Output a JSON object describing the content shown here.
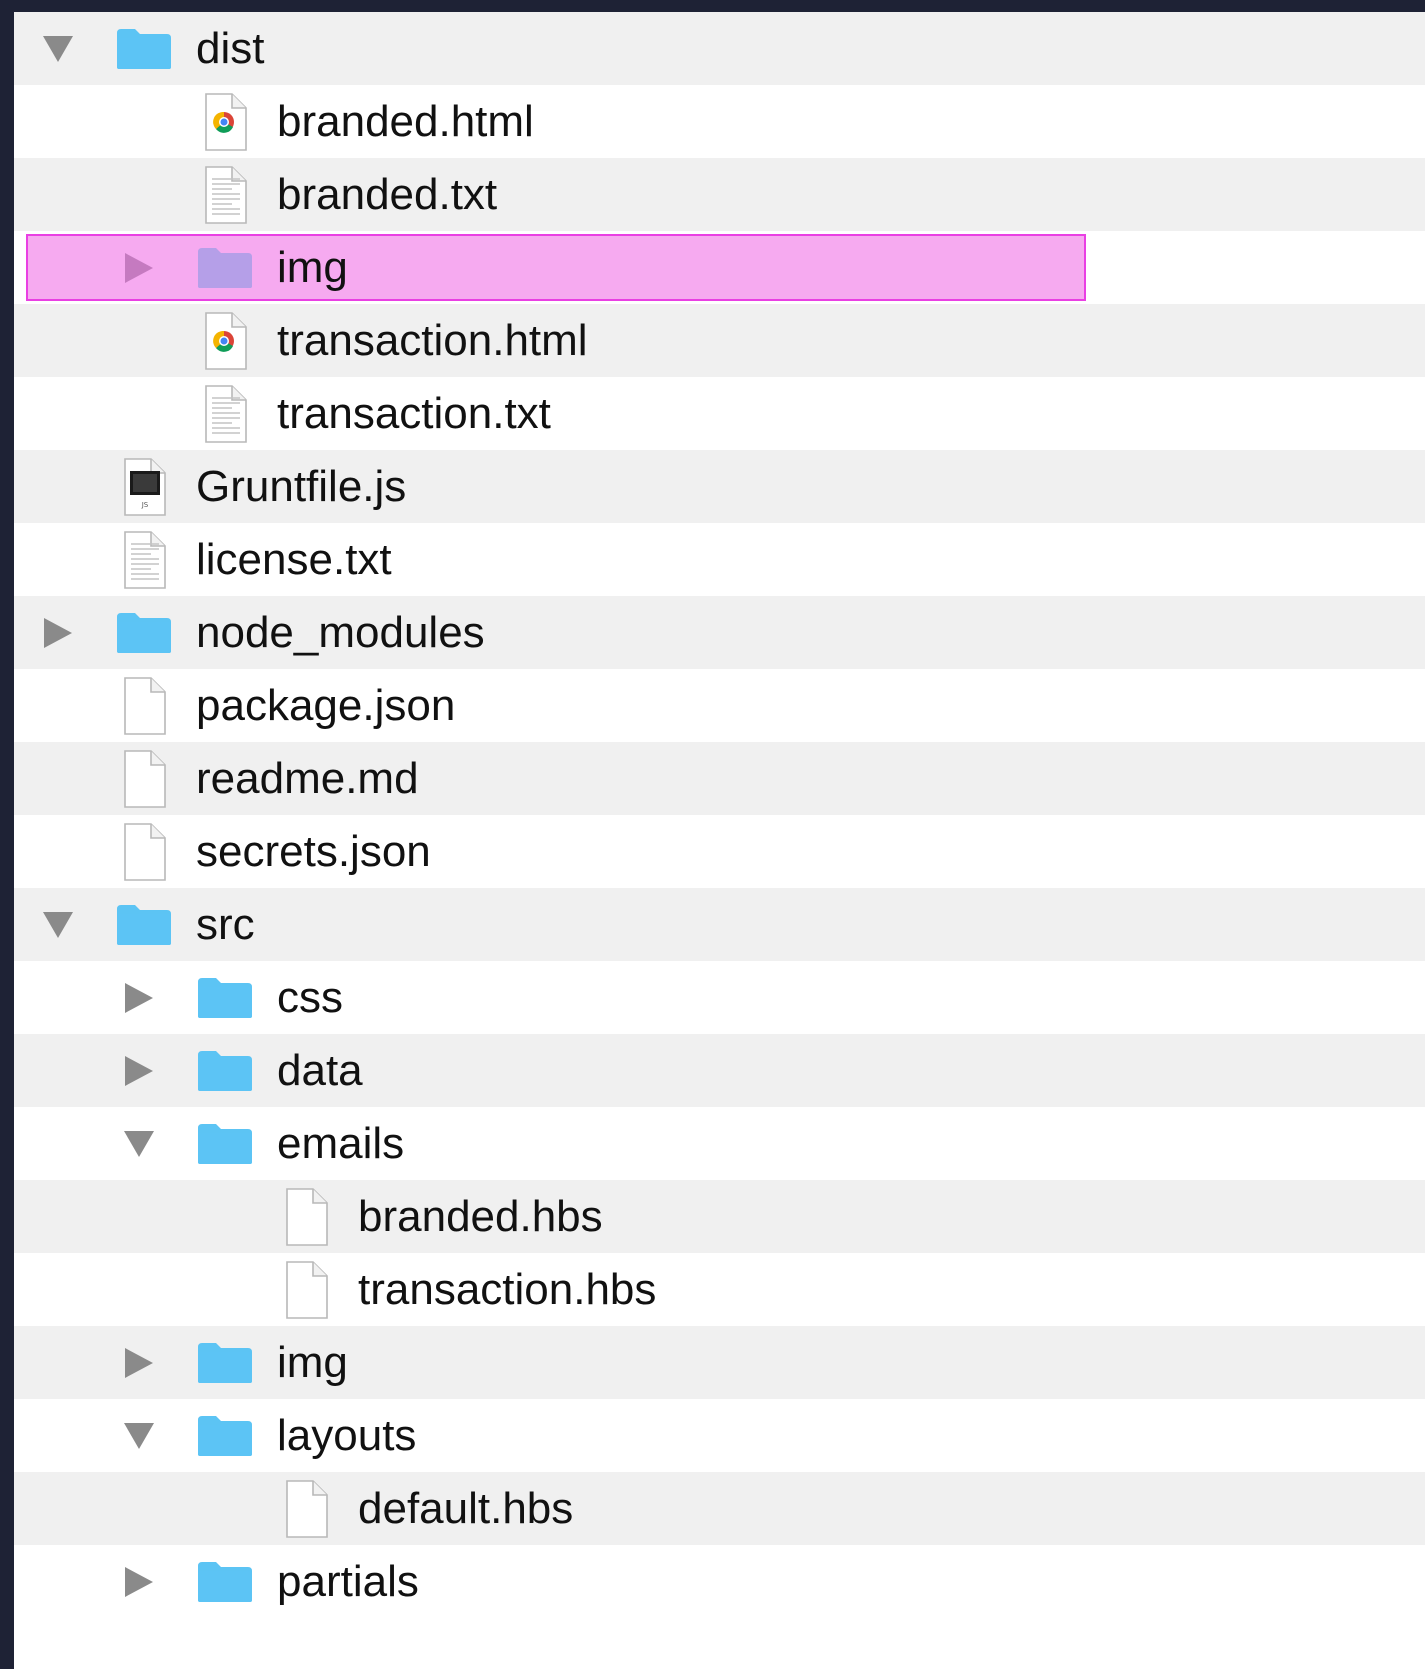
{
  "colors": {
    "background": "#1e2235",
    "row_odd": "#f0f0f0",
    "row_even": "#ffffff",
    "folder": "#5cc4f4",
    "highlight_fill": "#f6aaf0",
    "highlight_border": "#e93fe3"
  },
  "tree": {
    "rows": [
      {
        "name": "dist",
        "kind": "folder",
        "depth": 0,
        "disclosure": "expanded",
        "icon": "folder-icon"
      },
      {
        "name": "branded.html",
        "kind": "html",
        "depth": 1,
        "disclosure": "none",
        "icon": "chrome-html-file-icon"
      },
      {
        "name": "branded.txt",
        "kind": "text",
        "depth": 1,
        "disclosure": "none",
        "icon": "text-file-icon"
      },
      {
        "name": "img",
        "kind": "folder",
        "depth": 1,
        "disclosure": "collapsed",
        "icon": "folder-icon",
        "highlighted": true
      },
      {
        "name": "transaction.html",
        "kind": "html",
        "depth": 1,
        "disclosure": "none",
        "icon": "chrome-html-file-icon"
      },
      {
        "name": "transaction.txt",
        "kind": "text",
        "depth": 1,
        "disclosure": "none",
        "icon": "text-file-icon"
      },
      {
        "name": "Gruntfile.js",
        "kind": "js",
        "depth": 0,
        "disclosure": "none",
        "icon": "js-file-icon"
      },
      {
        "name": "license.txt",
        "kind": "text",
        "depth": 0,
        "disclosure": "none",
        "icon": "text-file-icon"
      },
      {
        "name": "node_modules",
        "kind": "folder",
        "depth": 0,
        "disclosure": "collapsed",
        "icon": "folder-icon"
      },
      {
        "name": "package.json",
        "kind": "blank",
        "depth": 0,
        "disclosure": "none",
        "icon": "blank-file-icon"
      },
      {
        "name": "readme.md",
        "kind": "blank",
        "depth": 0,
        "disclosure": "none",
        "icon": "blank-file-icon"
      },
      {
        "name": "secrets.json",
        "kind": "blank",
        "depth": 0,
        "disclosure": "none",
        "icon": "blank-file-icon"
      },
      {
        "name": "src",
        "kind": "folder",
        "depth": 0,
        "disclosure": "expanded",
        "icon": "folder-icon"
      },
      {
        "name": "css",
        "kind": "folder",
        "depth": 1,
        "disclosure": "collapsed",
        "icon": "folder-icon"
      },
      {
        "name": "data",
        "kind": "folder",
        "depth": 1,
        "disclosure": "collapsed",
        "icon": "folder-icon"
      },
      {
        "name": "emails",
        "kind": "folder",
        "depth": 1,
        "disclosure": "expanded",
        "icon": "folder-icon"
      },
      {
        "name": "branded.hbs",
        "kind": "blank",
        "depth": 2,
        "disclosure": "none",
        "icon": "blank-file-icon"
      },
      {
        "name": "transaction.hbs",
        "kind": "blank",
        "depth": 2,
        "disclosure": "none",
        "icon": "blank-file-icon"
      },
      {
        "name": "img",
        "kind": "folder",
        "depth": 1,
        "disclosure": "collapsed",
        "icon": "folder-icon"
      },
      {
        "name": "layouts",
        "kind": "folder",
        "depth": 1,
        "disclosure": "expanded",
        "icon": "folder-icon"
      },
      {
        "name": "default.hbs",
        "kind": "blank",
        "depth": 2,
        "disclosure": "none",
        "icon": "blank-file-icon"
      },
      {
        "name": "partials",
        "kind": "folder",
        "depth": 1,
        "disclosure": "collapsed",
        "icon": "folder-icon"
      }
    ]
  }
}
